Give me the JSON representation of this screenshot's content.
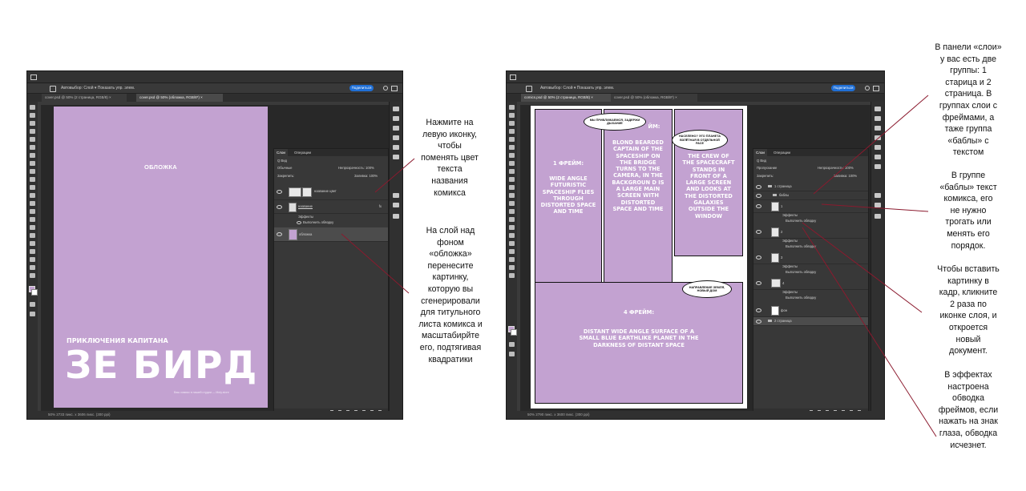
{
  "left_window": {
    "options_text": "Автовыбор:   Слой   ▾   Показать упр. элем.",
    "share_label": "Поделиться",
    "tabs": [
      "cover.psd @ 50% (2 страница, RGB/8) ×",
      "cover.psd @ 50% (обложка, RGB/8*) ×"
    ],
    "canvas": {
      "cover_label": "ОБЛОЖКА",
      "subtitle": "ПРИКЛЮЧЕНИЯ КАПИТАНА",
      "title": "ЗЕ БИРД",
      "footer": "Ваш комикс в нашей студии — Moly.store"
    },
    "status": "50%   2733 пикс. x 3606 пикс. (300 ppi)",
    "layers_panel": {
      "tabs": [
        "Слои",
        "Операции"
      ],
      "kind": "Q Вид",
      "mode": "Обычные",
      "opacity": "Непрозрачность: 100%",
      "lock": "Закрепить:",
      "fill": "Заливка: 100%",
      "layers": [
        {
          "name": "название цвет"
        },
        {
          "name": "название",
          "fx": "fx"
        },
        {
          "name": "Эффекты"
        },
        {
          "name": "Выполнить обводку"
        },
        {
          "name": "обложка"
        }
      ]
    }
  },
  "right_window": {
    "options_text": "Автовыбор:   Слой   ▾   Показать упр. элем.",
    "share_label": "Поделиться",
    "tabs": [
      "comics.psd @ 50% (2 страница, RGB/8) ×",
      "cover.psd @ 50% (обложка, RGB/8*) ×"
    ],
    "status": "50%   2790 пикс. x 3600 пикс. (300 ppi)",
    "panels": {
      "frame1": {
        "title": "1 ФРЕЙМ:",
        "text": "WIDE ANGLE FUTURISTIC SPACESHIP FLIES THROUGH DISTORTED SPACE AND TIME"
      },
      "frame2": {
        "title": "ЙМ:",
        "text": "BLOND BEARDED CAPTAIN OF THE SPACESHIP ON THE BRIDGE TURNS TO THE CAMERA, IN THE BACKGROUN D IS A LARGE MAIN SCREEN WITH DISTORTED SPACE AND TIME"
      },
      "frame3": {
        "title": "",
        "text": "THE CREW OF THE SPACECRAFT STANDS IN FRONT OF A LARGE SCREEN AND LOOKS AT THE DISTORTED GALAXIES OUTSIDE THE WINDOW"
      },
      "frame4": {
        "title": "4 ФРЕЙМ:",
        "text": "DISTANT WIDE ANGLE SURFACE OF A SMALL BLUE EARTHLIKE PLANET IN THE DARKNESS OF DISTANT SPACE"
      },
      "bubble1": "МЫ ПРИБЛИЖАЕМСЯ, ЗАДЕРЖИ ДЫХАНИЕ",
      "bubble2": "НАСЕЛЕНО? ЭТО ПЛАНЕТА ВЗЛЁТНАЯ В ОТДЕЛЬНОЙ РАСЕ",
      "bubble3": "НАПРАВЛЕНИЕ ЗЕМЛЯ, НОВЫЙ ДОМ"
    },
    "layers_panel": {
      "tabs": [
        "Слои",
        "Операции"
      ],
      "kind": "Q Вид",
      "mode": "Пропускание",
      "opacity": "Непрозрачность: 100%",
      "lock": "Закрепить:",
      "fill": "Заливка: 100%",
      "layers": [
        {
          "name": "1 страница"
        },
        {
          "name": "баблы"
        },
        {
          "name": "1"
        },
        {
          "name": "Эффекты"
        },
        {
          "name": "Выполнить обводку"
        },
        {
          "name": "2"
        },
        {
          "name": "Эффекты"
        },
        {
          "name": "Выполнить обводку"
        },
        {
          "name": "3"
        },
        {
          "name": "Эффекты"
        },
        {
          "name": "Выполнить обводку"
        },
        {
          "name": "4"
        },
        {
          "name": "Эффекты"
        },
        {
          "name": "Выполнить обводку"
        },
        {
          "name": "фон"
        },
        {
          "name": "2 страница"
        }
      ]
    }
  },
  "notes": {
    "left_top": [
      "Нажмите на",
      "левую иконку,",
      "чтобы",
      "поменять цвет",
      "текста",
      "названия",
      "комикса"
    ],
    "left_bottom": [
      "На слой над",
      "фоном",
      "«обложка»",
      "перенесите",
      "картинку,",
      "которую вы",
      "сгенерировали",
      "для титульного",
      "листа комикса и",
      "масштабирйте",
      "его, подтягивая",
      "квадратики"
    ],
    "right_1": [
      "В панели «слои»",
      "у вас есть две",
      "группы: 1",
      "старица и 2",
      "страница. В",
      "группах слои с",
      "фреймами, а",
      "таже группа",
      "«баблы» с",
      "текстом"
    ],
    "right_2": [
      "В группе",
      "«баблы» текст",
      "комикса, его",
      "не нужно",
      "трогать или",
      "менять его",
      "порядок."
    ],
    "right_3": [
      "Чтобы вставить",
      "картинку в",
      "кадр, кликните",
      "2 раза по",
      "иконке слоя, и",
      "откроется",
      "новый",
      "документ."
    ],
    "right_4": [
      "В эффектах",
      "настроена",
      "обводка",
      "фреймов, если",
      "нажать на знак",
      "глаза, обводка",
      "исчезнет."
    ]
  },
  "colors": {
    "lilac": "#c3a2d1",
    "pointer": "#8b1a2e",
    "ps_dark": "#282828",
    "accent_blue": "#1f6fd6"
  }
}
